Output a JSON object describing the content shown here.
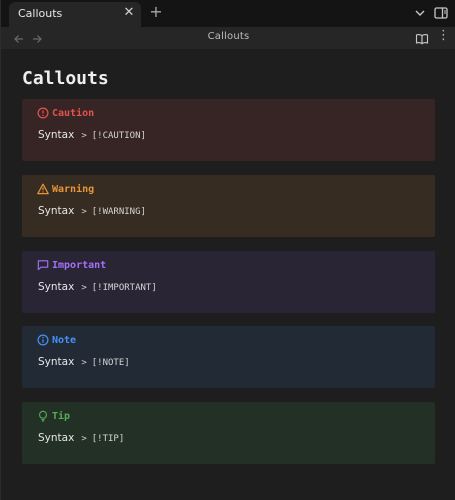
{
  "tab": {
    "title": "Callouts",
    "close_glyph": "✕"
  },
  "titlebar": {
    "new_tab_glyph": "+"
  },
  "nav": {
    "title": "Callouts",
    "more_glyph": "⋮"
  },
  "page": {
    "title": "Callouts"
  },
  "icons": {
    "tab_close": "close-icon",
    "new_tab": "plus-icon",
    "tab_list": "chevron-down-icon",
    "sidebar": "sidebar-toggle-icon",
    "back": "arrow-left-icon",
    "forward": "arrow-right-icon",
    "reading_view": "book-open-icon",
    "more": "more-vertical-icon"
  },
  "callouts": [
    {
      "name": "caution",
      "title": "Caution",
      "label": "Syntax",
      "arrow": ">",
      "code": "[!CAUTION]",
      "color": "#e5534b",
      "background": "#372425",
      "icon": "alert-circle-icon"
    },
    {
      "name": "warning",
      "title": "Warning",
      "label": "Syntax",
      "arrow": ">",
      "code": "[!WARNING]",
      "color": "#e8953a",
      "background": "#372c22",
      "icon": "alert-triangle-icon"
    },
    {
      "name": "important",
      "title": "Important",
      "label": "Syntax",
      "arrow": ">",
      "code": "[!IMPORTANT]",
      "color": "#a371f7",
      "background": "#2a2535",
      "icon": "message-square-icon"
    },
    {
      "name": "note",
      "title": "Note",
      "label": "Syntax",
      "arrow": ">",
      "code": "[!NOTE]",
      "color": "#4493f8",
      "background": "#222a36",
      "icon": "info-icon"
    },
    {
      "name": "tip",
      "title": "Tip",
      "label": "Syntax",
      "arrow": ">",
      "code": "[!TIP]",
      "color": "#57ab5a",
      "background": "#233025",
      "icon": "lightbulb-icon"
    }
  ]
}
